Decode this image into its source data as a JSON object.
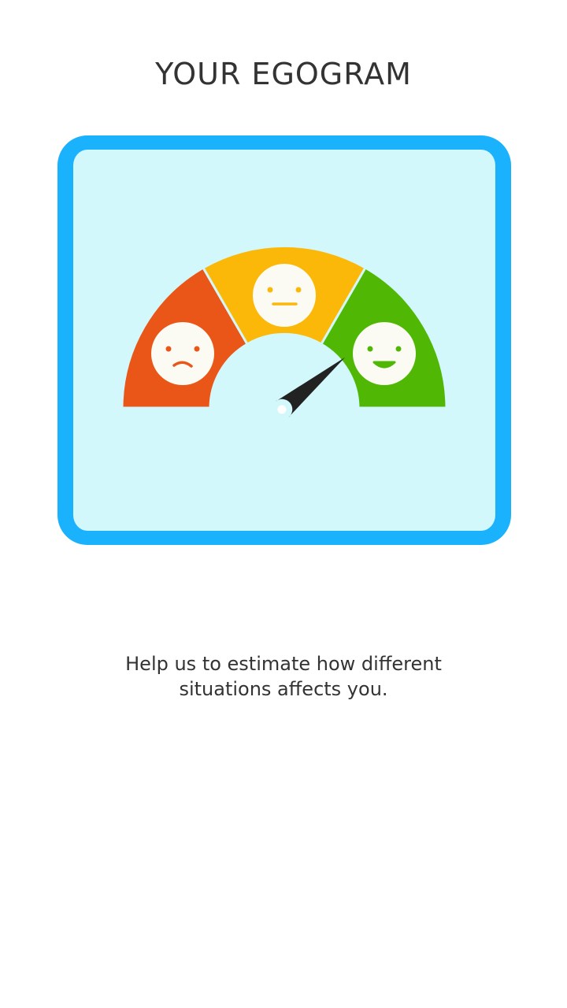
{
  "header": {
    "title": "YOUR EGOGRAM"
  },
  "gauge": {
    "segments": [
      {
        "mood": "sad",
        "color": "#ea5618"
      },
      {
        "mood": "neutral",
        "color": "#fcb809"
      },
      {
        "mood": "happy",
        "color": "#50b804"
      }
    ],
    "needle_level": 0.78,
    "colors": {
      "frame": "#1ab2fd",
      "background": "#d3f8fc",
      "face": "#fbfbf3",
      "needle": "#222222"
    }
  },
  "description": {
    "text": "Help us to estimate how different situations affects you."
  }
}
